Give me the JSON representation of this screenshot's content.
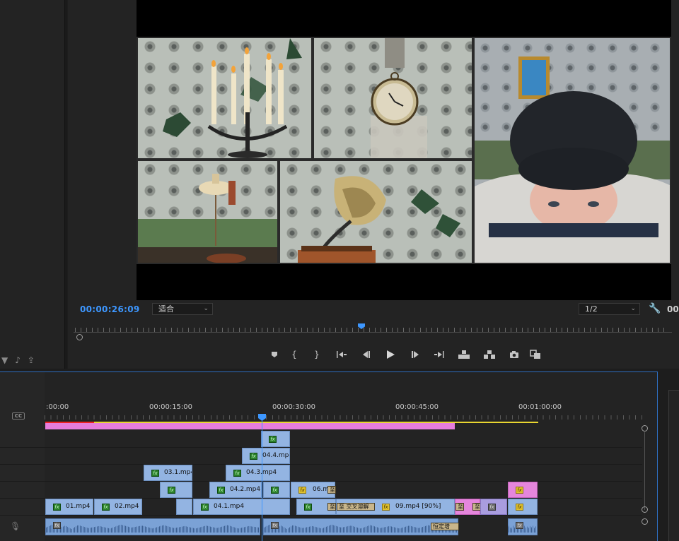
{
  "monitor": {
    "timecode": "00:00:26:09",
    "fit_value": "适合",
    "resolution_value": "1/2",
    "timecode_right": "00"
  },
  "controls": [
    {
      "name": "add-marker-button",
      "icon": "marker-icon",
      "glyph": "⯁"
    },
    {
      "name": "mark-in-button",
      "icon": "mark-in-icon",
      "glyph": "{"
    },
    {
      "name": "mark-out-button",
      "icon": "mark-out-icon",
      "glyph": "}"
    },
    {
      "name": "go-to-in-button",
      "icon": "go-to-in-icon",
      "glyph": "{⇤"
    },
    {
      "name": "step-back-button",
      "icon": "step-back-icon",
      "glyph": "◂|"
    },
    {
      "name": "play-button",
      "icon": "play-icon",
      "glyph": "▶"
    },
    {
      "name": "step-forward-button",
      "icon": "step-forward-icon",
      "glyph": "|▸"
    },
    {
      "name": "go-to-out-button",
      "icon": "go-to-out-icon",
      "glyph": "⇥}"
    },
    {
      "name": "lift-button",
      "icon": "lift-icon",
      "glyph": "⊞"
    },
    {
      "name": "extract-button",
      "icon": "extract-icon",
      "glyph": "⊟"
    },
    {
      "name": "export-frame-button",
      "icon": "camera-icon",
      "glyph": "◙"
    },
    {
      "name": "comparison-view-button",
      "icon": "compare-icon",
      "glyph": "▣"
    }
  ],
  "timeline": {
    "ruler": [
      ":00:00",
      "00:00:15:00",
      "00:00:30:00",
      "00:00:45:00",
      "00:01:00:00"
    ],
    "clips": {
      "c01": "01.mp4",
      "c02": "02.mp4",
      "c031": "03.1.mp4",
      "c041": "04.1.mp4",
      "c042": "04.2.mp4",
      "c043": "04.3.mp4",
      "c044": "04.4.mp4",
      "c06": "06.m",
      "c09": "09.mp4 [90%]"
    },
    "transitions": {
      "t1": "至",
      "t2": "至",
      "t3": "至",
      "t_cross": "至 交叉溶解",
      "t_right": "至"
    },
    "audio_label": "恒定增"
  },
  "colors": {
    "accent": "#3d97ff",
    "clip_blue": "#93b4e2",
    "clip_pink": "#e586dc",
    "clip_purple": "#a99ddf",
    "work_area": "#e77ddd"
  }
}
